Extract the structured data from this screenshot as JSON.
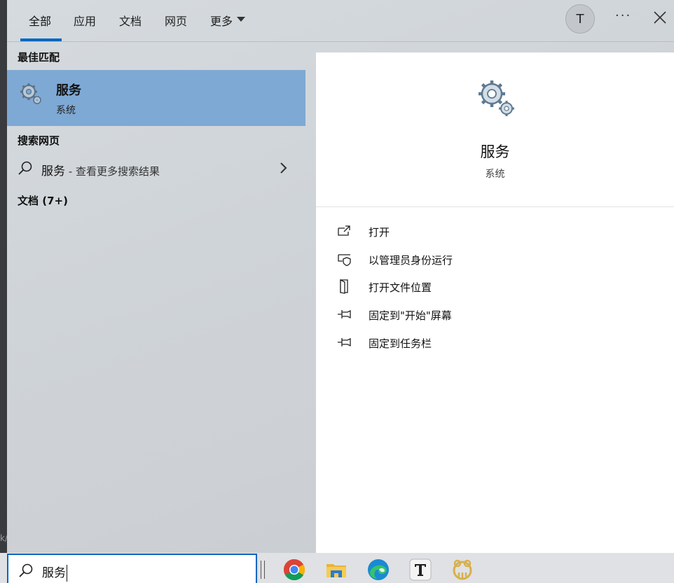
{
  "background": {
    "edge_text": "k/"
  },
  "tabs": [
    {
      "label": "全部",
      "active": true
    },
    {
      "label": "应用"
    },
    {
      "label": "文档"
    },
    {
      "label": "网页"
    },
    {
      "label": "更多"
    }
  ],
  "header": {
    "avatar_letter": "T",
    "more_label": "···"
  },
  "sections": {
    "best_match": "最佳匹配",
    "web_search": "搜索网页",
    "documents": "文档 (7+)"
  },
  "best_match_item": {
    "name": "服务",
    "type": "系统"
  },
  "web_item": {
    "query": "服务",
    "suffix": " - 查看更多搜索结果"
  },
  "detail": {
    "title": "服务",
    "subtitle": "系统",
    "actions": [
      {
        "label": "打开",
        "icon": "open-icon"
      },
      {
        "label": "以管理员身份运行",
        "icon": "shield-icon"
      },
      {
        "label": "打开文件位置",
        "icon": "file-location-icon"
      },
      {
        "label": "固定到\"开始\"屏幕",
        "icon": "pin-icon"
      },
      {
        "label": "固定到任务栏",
        "icon": "pin-icon"
      }
    ]
  },
  "taskbar": {
    "search_value": "服务",
    "apps": [
      "chrome-icon",
      "file-explorer-icon",
      "edge-icon",
      "typora-icon",
      "navicat-icon"
    ]
  },
  "colors": {
    "accent": "#0067c0",
    "selected": "#7ea9d4"
  }
}
